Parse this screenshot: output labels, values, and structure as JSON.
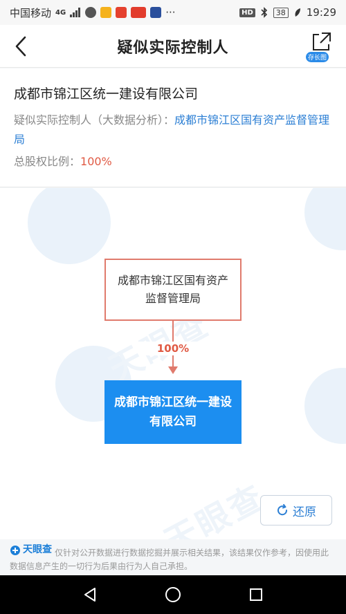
{
  "status_bar": {
    "carrier": "中国移动",
    "network": "4G",
    "time": "19:29",
    "battery": "38",
    "hd": "HD",
    "more": "···"
  },
  "header": {
    "title": "疑似实际控制人",
    "share_badge": "存长图"
  },
  "info": {
    "company_name": "成都市锦江区统一建设有限公司",
    "controller_label": "疑似实际控制人（大数据分析）：",
    "controller_value": "成都市锦江区国有资产监督管理局",
    "ratio_label": "总股权比例：",
    "ratio_value": "100%"
  },
  "diagram": {
    "top_node": "成都市锦江区国有资产监督管理局",
    "edge_percent": "100%",
    "bottom_node": "成都市锦江区统一建设有限公司",
    "restore_label": "还原",
    "watermark": "天眼查"
  },
  "footer": {
    "brand": "天眼查",
    "disclaimer": "仅针对公开数据进行数据挖掘并展示相关结果，该结果仅作参考，因使用此数据信息产生的一切行为后果由行为人自己承担。"
  },
  "colors": {
    "accent_blue": "#1c8ef0",
    "edge_red": "#e07a6c",
    "link_blue": "#2c7fd4"
  }
}
